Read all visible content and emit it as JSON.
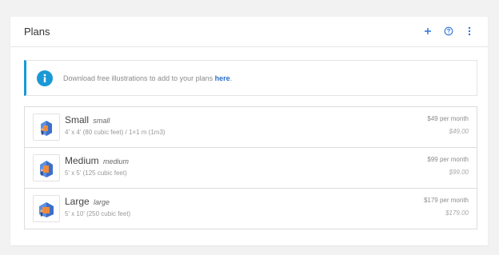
{
  "header": {
    "title": "Plans",
    "icons": [
      "plus-icon",
      "help-icon",
      "more-vertical-icon"
    ]
  },
  "info": {
    "icon": "info-icon",
    "text": "Download free illustrations to add to your plans ",
    "link": "here",
    "trailing": "."
  },
  "plans": [
    {
      "name": "Small",
      "slug": "small",
      "size": "4' x 4' (80 cubic feet) / 1×1 m (1m3)",
      "price": "$49 per month",
      "total": "$49.00"
    },
    {
      "name": "Medium",
      "slug": "medium",
      "size": "5' x 5' (125 cubic feet)",
      "price": "$99 per month",
      "total": "$99.00"
    },
    {
      "name": "Large",
      "slug": "large",
      "size": "5' x 10' (250 cubic feet)",
      "price": "$179 per month",
      "total": "$179.00"
    }
  ],
  "colors": {
    "accent": "#1a99d6",
    "link": "#2a70c9",
    "icon_blue": "#2b73d6"
  }
}
